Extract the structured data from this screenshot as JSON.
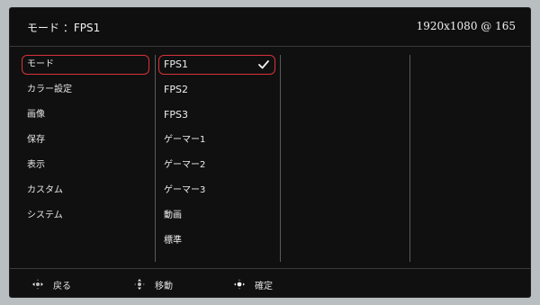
{
  "header": {
    "title": "モード ：FPS1",
    "resolution": "1920x1080 @ 165"
  },
  "main_menu": {
    "items": [
      {
        "label": "モード",
        "selected": true
      },
      {
        "label": "カラー設定",
        "selected": false
      },
      {
        "label": "画像",
        "selected": false
      },
      {
        "label": "保存",
        "selected": false
      },
      {
        "label": "表示",
        "selected": false
      },
      {
        "label": "カスタム",
        "selected": false
      },
      {
        "label": "システム",
        "selected": false
      }
    ]
  },
  "mode_options": {
    "items": [
      {
        "label": "FPS1",
        "selected": true,
        "checked": true
      },
      {
        "label": "FPS2",
        "selected": false
      },
      {
        "label": "FPS3",
        "selected": false
      },
      {
        "label": "ゲーマー1",
        "selected": false
      },
      {
        "label": "ゲーマー2",
        "selected": false
      },
      {
        "label": "ゲーマー3",
        "selected": false
      },
      {
        "label": "動画",
        "selected": false
      },
      {
        "label": "標準",
        "selected": false
      }
    ]
  },
  "footer": {
    "back_label": "戻る",
    "move_label": "移動",
    "confirm_label": "確定"
  },
  "colors": {
    "highlight": "#d8323a",
    "background": "#101010",
    "text": "#e8e8e8"
  },
  "icons": {
    "check": "check-icon",
    "back": "dpad-left-right-icon",
    "move": "dpad-up-down-icon",
    "confirm": "dpad-center-icon"
  }
}
